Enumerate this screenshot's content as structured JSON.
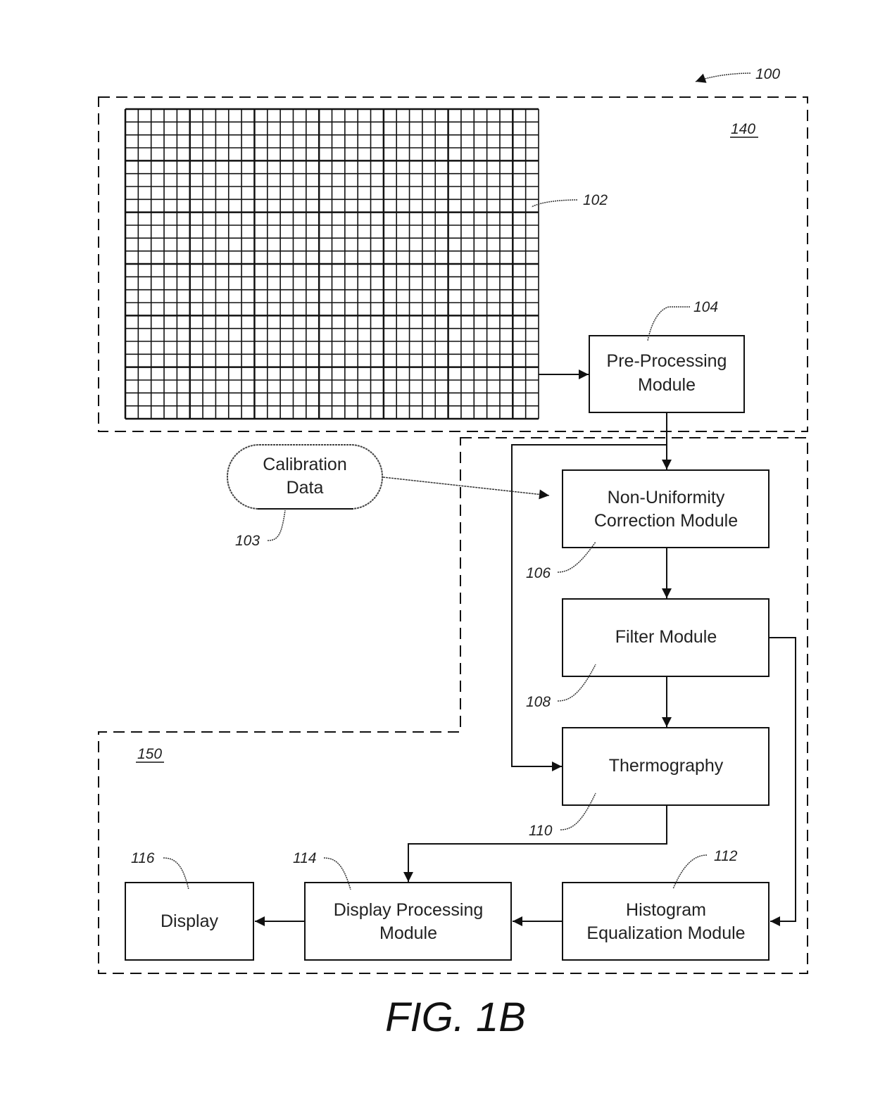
{
  "figure": {
    "caption": "FIG. 1B",
    "system_ref": "100"
  },
  "regions": {
    "sensor_region_ref": "140",
    "processing_region_ref": "150"
  },
  "sensor_array": {
    "ref": "102",
    "columns": 32,
    "rows": 24
  },
  "calibration": {
    "line1": "Calibration",
    "line2": "Data",
    "ref": "103"
  },
  "modules": {
    "pre_processing": {
      "line1": "Pre-Processing",
      "line2": "Module",
      "ref": "104"
    },
    "nuc": {
      "line1": "Non-Uniformity",
      "line2": "Correction Module",
      "ref": "106"
    },
    "filter": {
      "line1": "Filter Module",
      "ref": "108"
    },
    "thermography": {
      "line1": "Thermography",
      "ref": "110"
    },
    "histogram": {
      "line1": "Histogram",
      "line2": "Equalization Module",
      "ref": "112"
    },
    "display_processing": {
      "line1": "Display Processing",
      "line2": "Module",
      "ref": "114"
    },
    "display": {
      "line1": "Display",
      "ref": "116"
    }
  }
}
